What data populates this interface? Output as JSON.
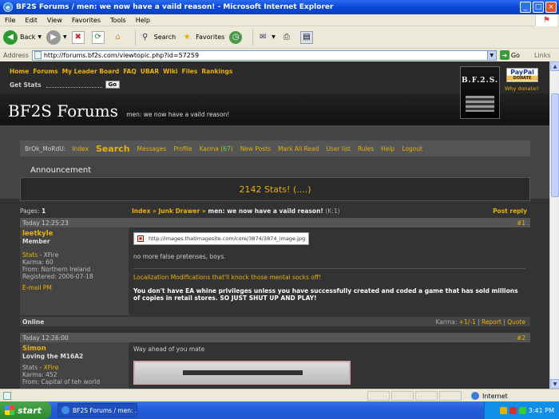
{
  "window": {
    "title": "BF2S Forums / men: we now have a vaild reason! - Microsoft Internet Explorer"
  },
  "menu": [
    "File",
    "Edit",
    "View",
    "Favorites",
    "Tools",
    "Help"
  ],
  "toolbar": {
    "back": "Back",
    "search": "Search",
    "favorites": "Favorites"
  },
  "address": {
    "label": "Address",
    "url": "http://forums.bf2s.com/viewtopic.php?id=57259",
    "go": "Go",
    "links": "Links"
  },
  "site": {
    "nav": [
      "Home",
      "Forums",
      "My Leader Board",
      "FAQ",
      "UBAR",
      "Wiki",
      "Files",
      "Rankings"
    ],
    "get_stats": "Get Stats",
    "go": "Go",
    "logo": "B.F.2.S.",
    "paypal": "PayPal",
    "donate": "DONATE",
    "why_donate": "Why donate?",
    "forum_title": "BF2S Forums",
    "forum_subtitle": "men: we now have a vaild reason!"
  },
  "userbar": {
    "user": "BrOk_MoRdU:",
    "index": "Index",
    "search": "Search",
    "messages": "Messages",
    "profile": "Profile",
    "karma": "Karma",
    "karma_value": "67",
    "links": [
      "New Posts",
      "Mark All Read",
      "User list",
      "Rules",
      "Help",
      "Logout"
    ]
  },
  "announcement": {
    "title": "Announcement",
    "text": "2142 Stats! (....)"
  },
  "topic": {
    "pages_label": "Pages:",
    "pages_value": "1",
    "crumb_index": "Index",
    "crumb_forum": "Junk Drawer",
    "crumb_topic": "men: we now have a vaild reason!",
    "crumb_extra": "(K:1)",
    "post_reply": "Post reply"
  },
  "posts": [
    {
      "time": "Today 12:25:23",
      "num": "#1",
      "author": "leetkyle",
      "rank": "Member",
      "stats": "Stats",
      "stats_sep": "-",
      "stats_link": "XFire",
      "karma": "Karma: 60",
      "from": "From: Northern Ireland",
      "registered": "Registered: 2006-07-18",
      "email": "E-mail",
      "pm": "PM",
      "image_url": "http://images.thatimagesite.com/core/3874/3874_image.jpg",
      "text": "no more false pretenses, boys.",
      "sig_link": "Localization Modifications that'll knock those mental socks off!",
      "sig_bold": "You don't have EA whine privileges unless you have successfully created and coded a game that has sold millions of copies in retail stores. SO JUST SHUT UP AND PLAY!",
      "status": "Online",
      "karma_label": "Karma:",
      "karma_actions": "+1/-1",
      "report": "Report",
      "quote": "Quote"
    },
    {
      "time": "Today 12:26:00",
      "num": "#2",
      "author": "Simon",
      "rank": "Loving the M16A2",
      "stats": "Stats",
      "stats_sep": "-",
      "stats_link": "XFire",
      "karma": "Karma: 452",
      "from": "From: Capital of teh world",
      "text": "Way ahead of you mate"
    }
  ],
  "status": {
    "zone": "Internet"
  },
  "taskbar": {
    "start": "start",
    "task": "BF2S Forums / men: ...",
    "time": "3:41 PM"
  }
}
